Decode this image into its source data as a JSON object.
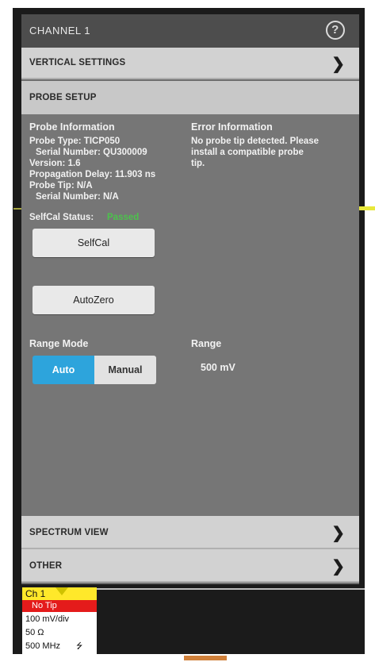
{
  "header": {
    "title": "CHANNEL 1",
    "help_icon": "?"
  },
  "sections": {
    "vertical_settings": "VERTICAL SETTINGS",
    "probe_setup": "PROBE SETUP",
    "spectrum_view": "SPECTRUM VIEW",
    "other": "OTHER"
  },
  "probe_info": {
    "heading": "Probe Information",
    "type": "Probe Type: TICP050",
    "serial": "Serial Number: QU300009",
    "version": "Version: 1.6",
    "delay": "Propagation Delay: 11.903 ns",
    "tip": "Probe Tip: N/A",
    "tip_serial": "Serial Number: N/A"
  },
  "error_info": {
    "heading": "Error Information",
    "line1": "No probe tip detected. Please",
    "line2": "install a compatible probe",
    "line3": "tip."
  },
  "selfcal": {
    "label": "SelfCal Status:",
    "status": "Passed",
    "button": "SelfCal"
  },
  "autozero": {
    "button": "AutoZero"
  },
  "range_mode": {
    "label": "Range Mode",
    "options": [
      "Auto",
      "Manual"
    ],
    "selected": "Auto"
  },
  "range": {
    "label": "Range",
    "value": "500 mV"
  },
  "channel_badge": {
    "label": "Ch 1",
    "warning": "No Tip",
    "scale": "100 mV/div",
    "impedance": "50 Ω",
    "bandwidth": "500 MHz"
  },
  "colors": {
    "accent": "#2da4dc",
    "channel": "#ffe82a",
    "warning": "#e41b1b",
    "status_ok": "#4cc24c"
  }
}
